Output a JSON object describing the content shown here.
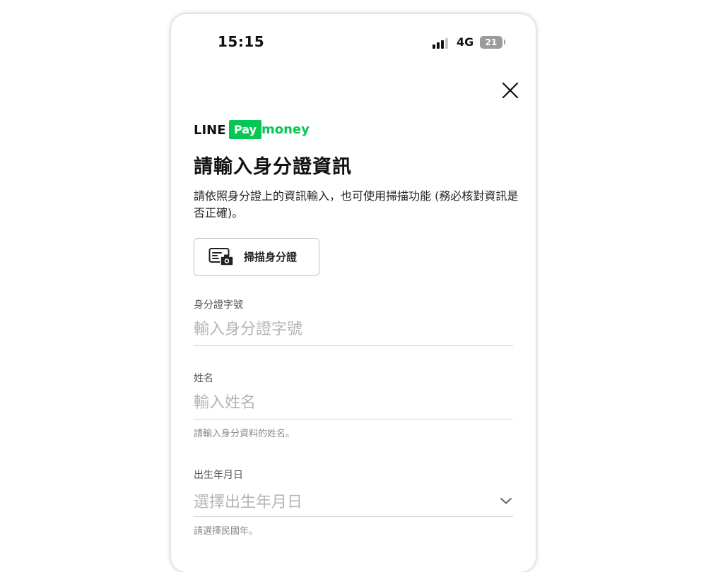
{
  "status_bar": {
    "time": "15:15",
    "network": "4G",
    "battery": "21"
  },
  "header": {
    "logo": {
      "line": "LINE",
      "pay": "Pay",
      "money": "money"
    },
    "title": "請輸入身分證資訊",
    "description": "請依照身分證上的資訊輸入，也可使用掃描功能 (務必核對資訊是否正確)。"
  },
  "scan_button": {
    "label": "掃描身分證",
    "icon": "id-card-camera-icon"
  },
  "form": {
    "id_number": {
      "label": "身分證字號",
      "placeholder": "輸入身分證字號",
      "value": ""
    },
    "name": {
      "label": "姓名",
      "placeholder": "輸入姓名",
      "value": "",
      "hint": "請輸入身分資料的姓名。"
    },
    "birthdate": {
      "label": "出生年月日",
      "placeholder": "選擇出生年月日",
      "hint": "請選擇民國年。"
    }
  },
  "colors": {
    "brand_green": "#06c755",
    "text_primary": "#111111",
    "placeholder": "#b5b5b5",
    "divider": "#d8d8d8"
  }
}
